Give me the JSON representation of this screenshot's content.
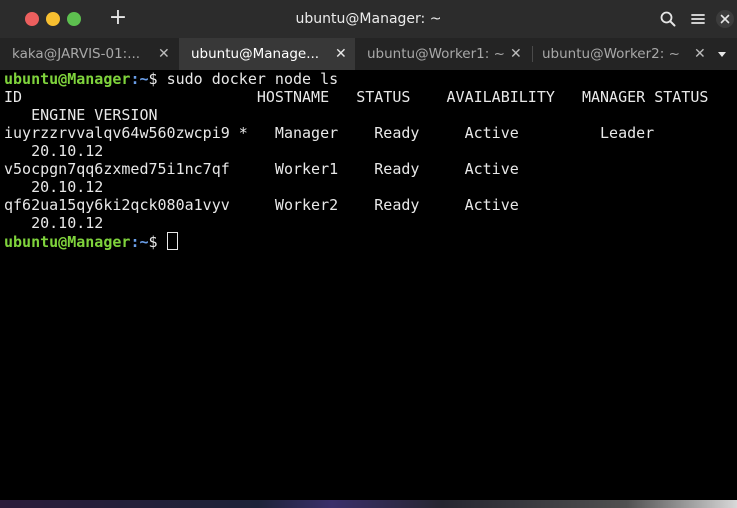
{
  "window": {
    "title": "ubuntu@Manager: ~"
  },
  "titlebar": {
    "new_tab_icon": "plus-icon",
    "search_icon": "search-icon",
    "menu_icon": "hamburger-menu-icon",
    "close_icon": "close-icon"
  },
  "tabs": [
    {
      "label": "kaka@JARVIS-01:...",
      "close": "✕",
      "active": false
    },
    {
      "label": "ubuntu@Manage...",
      "close": "✕",
      "active": true
    },
    {
      "label": "ubuntu@Worker1: ~",
      "close": "✕",
      "active": false
    },
    {
      "label": "ubuntu@Worker2: ~",
      "close": "✕",
      "active": false
    }
  ],
  "terminal": {
    "prompt_user": "ubuntu@Manager",
    "prompt_path": ":~",
    "prompt_symbol": "$ ",
    "command": "sudo docker node ls",
    "header_line1": "ID                          HOSTNAME   STATUS    AVAILABILITY   MANAGER STATUS",
    "header_line2": "   ENGINE VERSION",
    "rows": [
      {
        "line1": "iuyrzzrvvalqv64w560zwcpi9 *   Manager    Ready     Active         Leader",
        "line2": "   20.10.12"
      },
      {
        "line1": "v5ocpgn7qq6zxmed75i1nc7qf     Worker1    Ready     Active",
        "line2": "   20.10.12"
      },
      {
        "line1": "qf62ua15qy6ki2qck080a1vyv     Worker2    Ready     Active",
        "line2": "   20.10.12"
      }
    ]
  },
  "colors": {
    "prompt_user": "#7fd33c",
    "prompt_path": "#6a9ee8",
    "terminal_bg": "#000000",
    "terminal_fg": "#e8e8e8"
  }
}
